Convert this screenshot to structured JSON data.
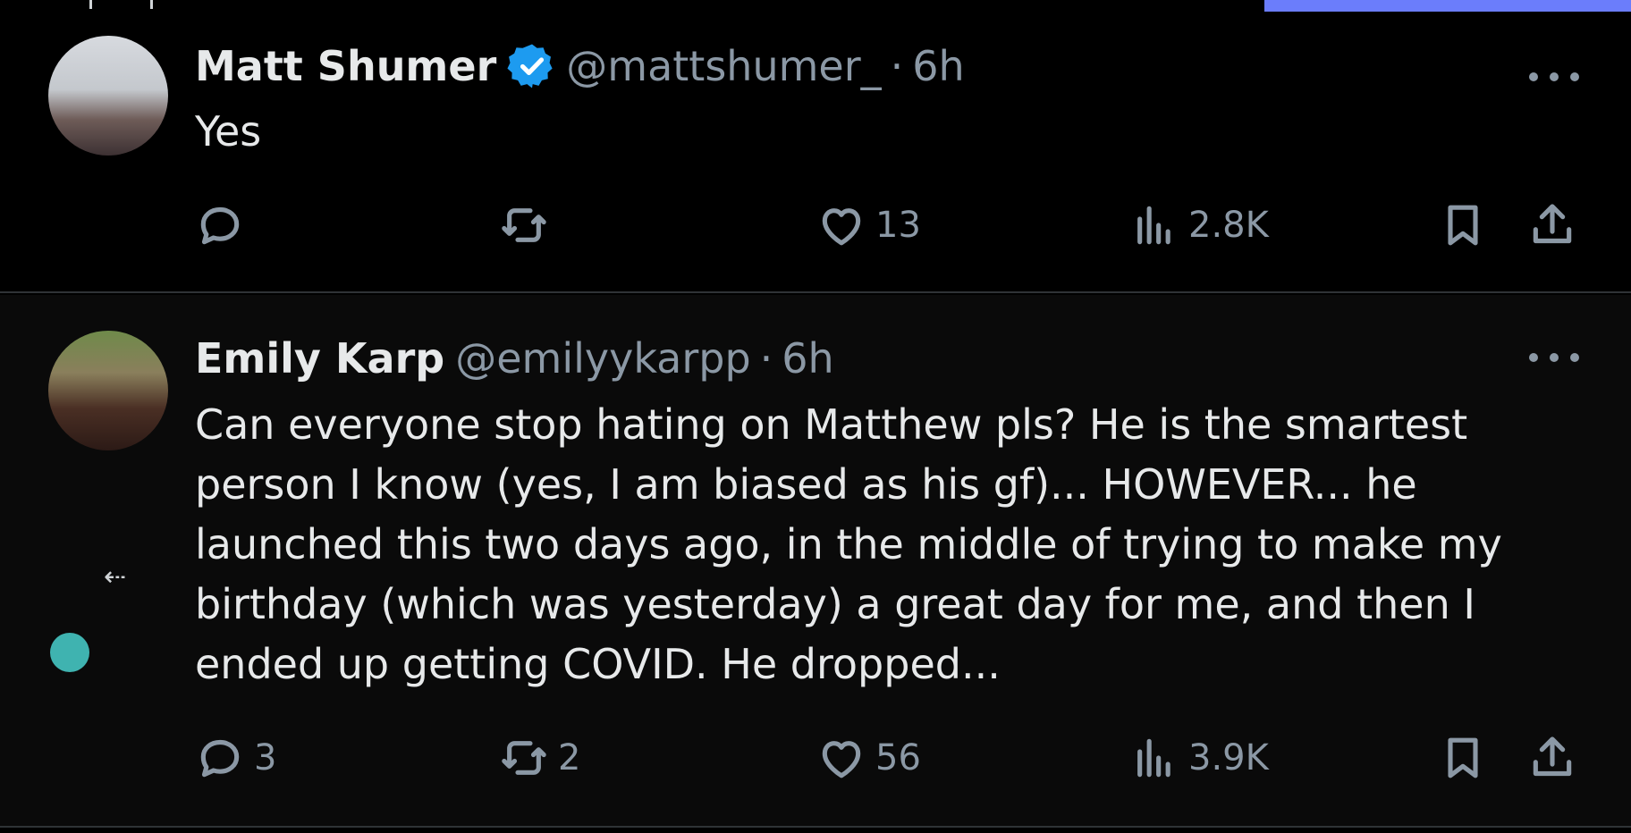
{
  "tweets": [
    {
      "name": "Matt Shumer",
      "verified": true,
      "handle": "@mattshumer_",
      "separator": "·",
      "time": "6h",
      "text": "Yes",
      "replies": "",
      "retweets": "",
      "likes": "13",
      "views": "2.8K"
    },
    {
      "name": "Emily Karp",
      "verified": false,
      "handle": "@emilyykarpp",
      "separator": "·",
      "time": "6h",
      "text": "Can everyone stop hating on Matthew pls? He is the smartest person I know (yes, I am biased as his gf)... HOWEVER... he launched this two days ago, in the middle of trying to make my birthday (which was yesterday) a great day for me, and then I ended up getting COVID. He dropped...",
      "replies": "3",
      "retweets": "2",
      "likes": "56",
      "views": "3.9K"
    }
  ],
  "icons": {
    "verified": "verified-badge-icon",
    "more": "more-icon",
    "reply": "reply-icon",
    "retweet": "retweet-icon",
    "like": "heart-icon",
    "views": "views-icon",
    "bookmark": "bookmark-icon",
    "share": "share-icon",
    "left_arrow": "left-arrow-icon"
  },
  "colors": {
    "background": "#000000",
    "text": "#e7e9ea",
    "secondary": "#8b98a5",
    "verified": "#1d9bf0",
    "accent_bar": "#6b7dfb",
    "teal_dot": "#3fb3b0"
  }
}
